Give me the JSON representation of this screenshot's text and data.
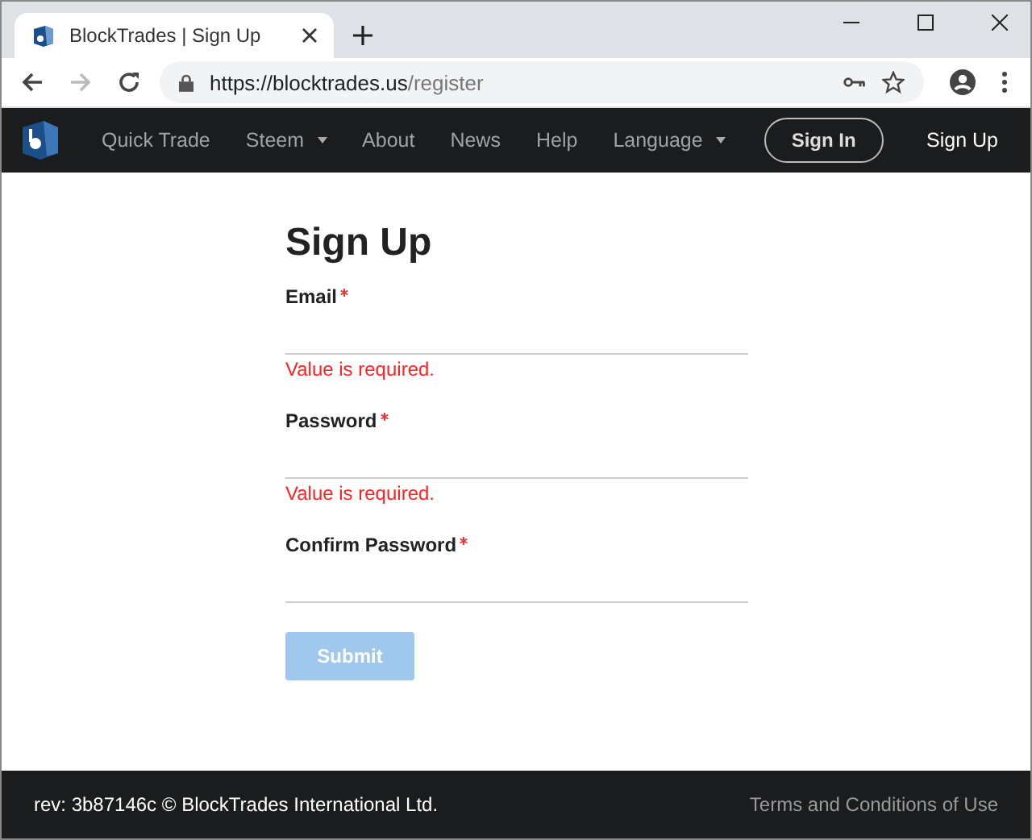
{
  "browser": {
    "tab_title": "BlockTrades | Sign Up",
    "url_host": "https://blocktrades.us",
    "url_path": "/register"
  },
  "nav": {
    "items": [
      {
        "label": "Quick Trade",
        "dropdown": false
      },
      {
        "label": "Steem",
        "dropdown": true
      },
      {
        "label": "About",
        "dropdown": false
      },
      {
        "label": "News",
        "dropdown": false
      },
      {
        "label": "Help",
        "dropdown": false
      },
      {
        "label": "Language",
        "dropdown": true
      }
    ],
    "sign_in": "Sign In",
    "sign_up": "Sign Up"
  },
  "form": {
    "title": "Sign Up",
    "fields": [
      {
        "label": "Email",
        "required": true,
        "error": "Value is required."
      },
      {
        "label": "Password",
        "required": true,
        "error": "Value is required."
      },
      {
        "label": "Confirm Password",
        "required": true
      }
    ],
    "submit": {
      "label": "Submit",
      "disabled": true
    }
  },
  "footer": {
    "copyright": "rev: 3b87146c © BlockTrades International Ltd.",
    "terms": "Terms and Conditions of Use"
  }
}
